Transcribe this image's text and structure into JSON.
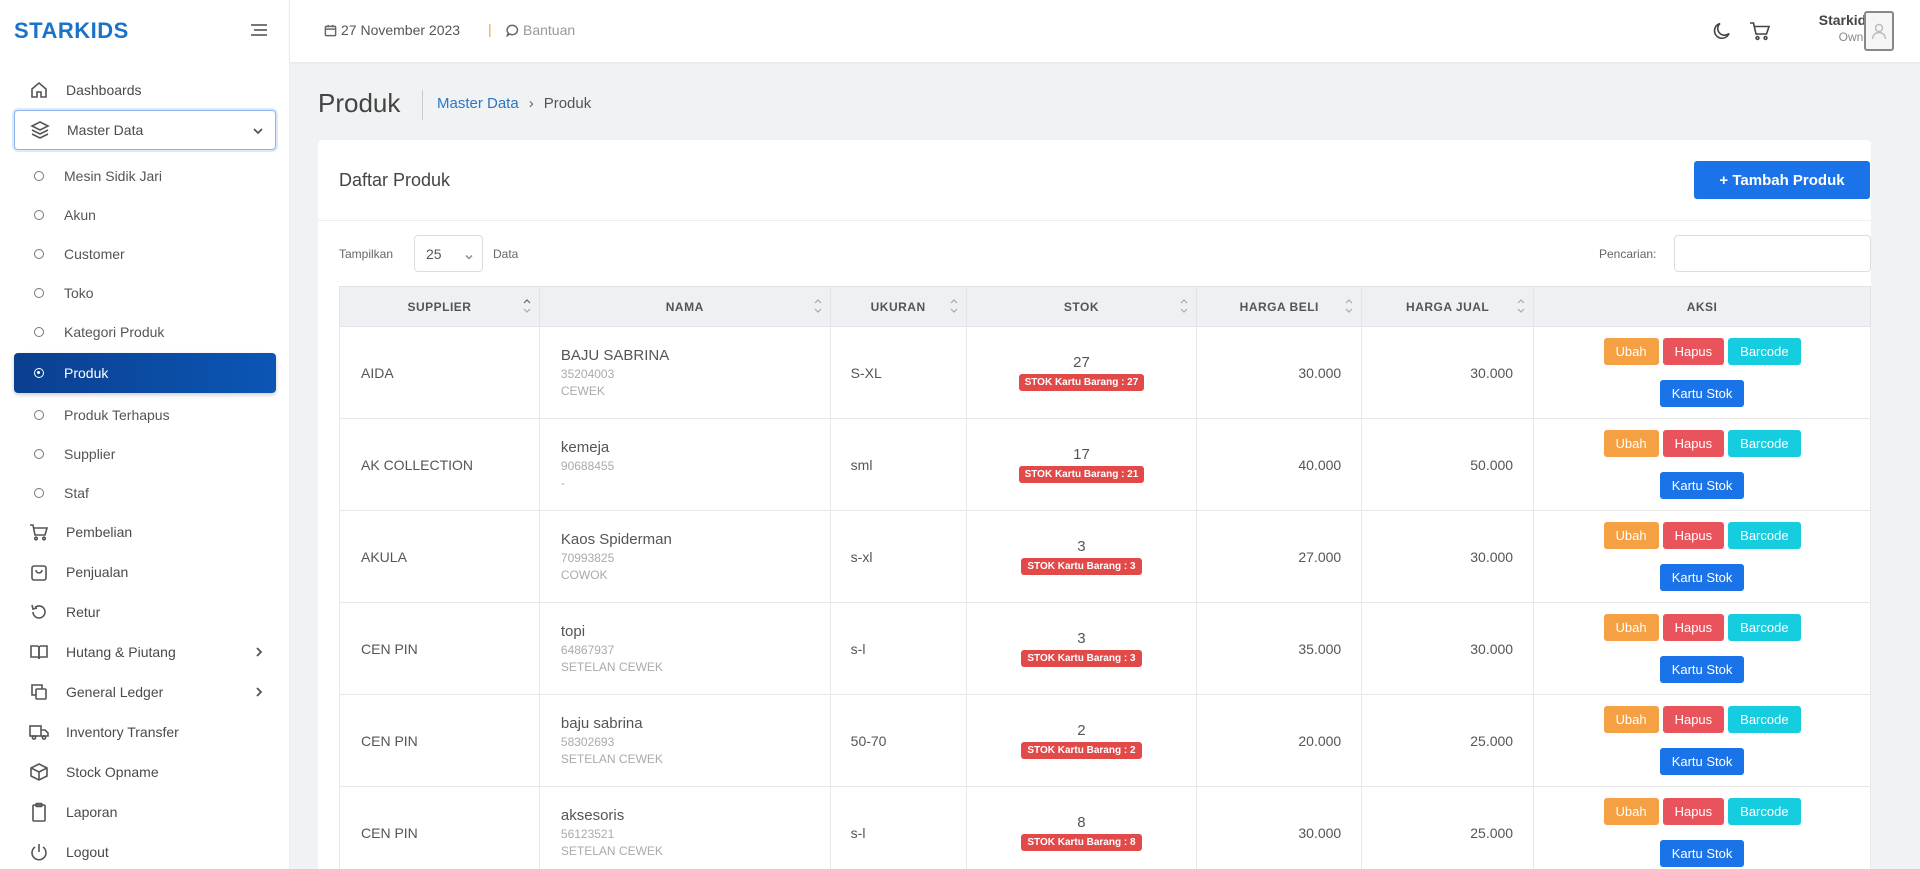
{
  "brand": "STARKIDS",
  "sidebar": {
    "items": [
      {
        "label": "Dashboards",
        "icon": "home-icon"
      },
      {
        "label": "Master Data",
        "icon": "layers-icon"
      },
      {
        "label": "Pembelian",
        "icon": "cart-icon"
      },
      {
        "label": "Penjualan",
        "icon": "bag-icon"
      },
      {
        "label": "Retur",
        "icon": "undo-icon"
      },
      {
        "label": "Hutang & Piutang",
        "icon": "book-icon"
      },
      {
        "label": "General Ledger",
        "icon": "copy-icon"
      },
      {
        "label": "Inventory Transfer",
        "icon": "truck-icon"
      },
      {
        "label": "Stock Opname",
        "icon": "box-icon"
      },
      {
        "label": "Laporan",
        "icon": "clipboard-icon"
      },
      {
        "label": "Logout",
        "icon": "power-icon"
      }
    ],
    "sub_items": [
      "Mesin Sidik Jari",
      "Akun",
      "Customer",
      "Toko",
      "Kategori Produk",
      "Produk",
      "Produk Terhapus",
      "Supplier",
      "Staf"
    ]
  },
  "topbar": {
    "date": "27 November 2023",
    "separator": "|",
    "help": "Bantuan",
    "user_name": "Starkids",
    "user_role": "Owner"
  },
  "page": {
    "title": "Produk",
    "breadcrumb_parent": "Master Data",
    "breadcrumb_current": "Produk"
  },
  "card": {
    "title": "Daftar Produk",
    "add_button": "+ Tambah Produk",
    "show_label": "Tampilkan",
    "show_value": "25",
    "data_label": "Data",
    "search_label": "Pencarian:"
  },
  "table": {
    "headers": [
      "SUPPLIER",
      "NAMA",
      "UKURAN",
      "STOK",
      "HARGA BELI",
      "HARGA JUAL",
      "AKSI"
    ],
    "actions": {
      "edit": "Ubah",
      "delete": "Hapus",
      "barcode": "Barcode",
      "stock_card": "Kartu Stok"
    },
    "rows": [
      {
        "supplier": "AIDA",
        "name": "BAJU SABRINA",
        "code": "35204003",
        "category": "CEWEK",
        "size": "S-XL",
        "stock": "27",
        "stock_badge": "STOK Kartu Barang : 27",
        "buy": "30.000",
        "sell": "30.000"
      },
      {
        "supplier": "AK COLLECTION",
        "name": "kemeja",
        "code": "90688455",
        "category": "-",
        "size": "sml",
        "stock": "17",
        "stock_badge": "STOK Kartu Barang : 21",
        "buy": "40.000",
        "sell": "50.000"
      },
      {
        "supplier": "AKULA",
        "name": "Kaos Spiderman",
        "code": "70993825",
        "category": "COWOK",
        "size": "s-xl",
        "stock": "3",
        "stock_badge": "STOK Kartu Barang : 3",
        "buy": "27.000",
        "sell": "30.000"
      },
      {
        "supplier": "CEN PIN",
        "name": "topi",
        "code": "64867937",
        "category": "SETELAN CEWEK",
        "size": "s-l",
        "stock": "3",
        "stock_badge": "STOK Kartu Barang : 3",
        "buy": "35.000",
        "sell": "30.000"
      },
      {
        "supplier": "CEN PIN",
        "name": "baju sabrina",
        "code": "58302693",
        "category": "SETELAN CEWEK",
        "size": "50-70",
        "stock": "2",
        "stock_badge": "STOK Kartu Barang : 2",
        "buy": "20.000",
        "sell": "25.000"
      },
      {
        "supplier": "CEN PIN",
        "name": "aksesoris",
        "code": "56123521",
        "category": "SETELAN CEWEK",
        "size": "s-l",
        "stock": "8",
        "stock_badge": "STOK Kartu Barang : 8",
        "buy": "30.000",
        "sell": "25.000"
      }
    ]
  },
  "colors": {
    "brand": "#1a73c9",
    "active_menu": "#0b4fa8",
    "edit": "#f5a043",
    "delete": "#e9545c",
    "barcode": "#16cde0",
    "primary": "#1a73e8",
    "badge": "#e24a4a"
  }
}
